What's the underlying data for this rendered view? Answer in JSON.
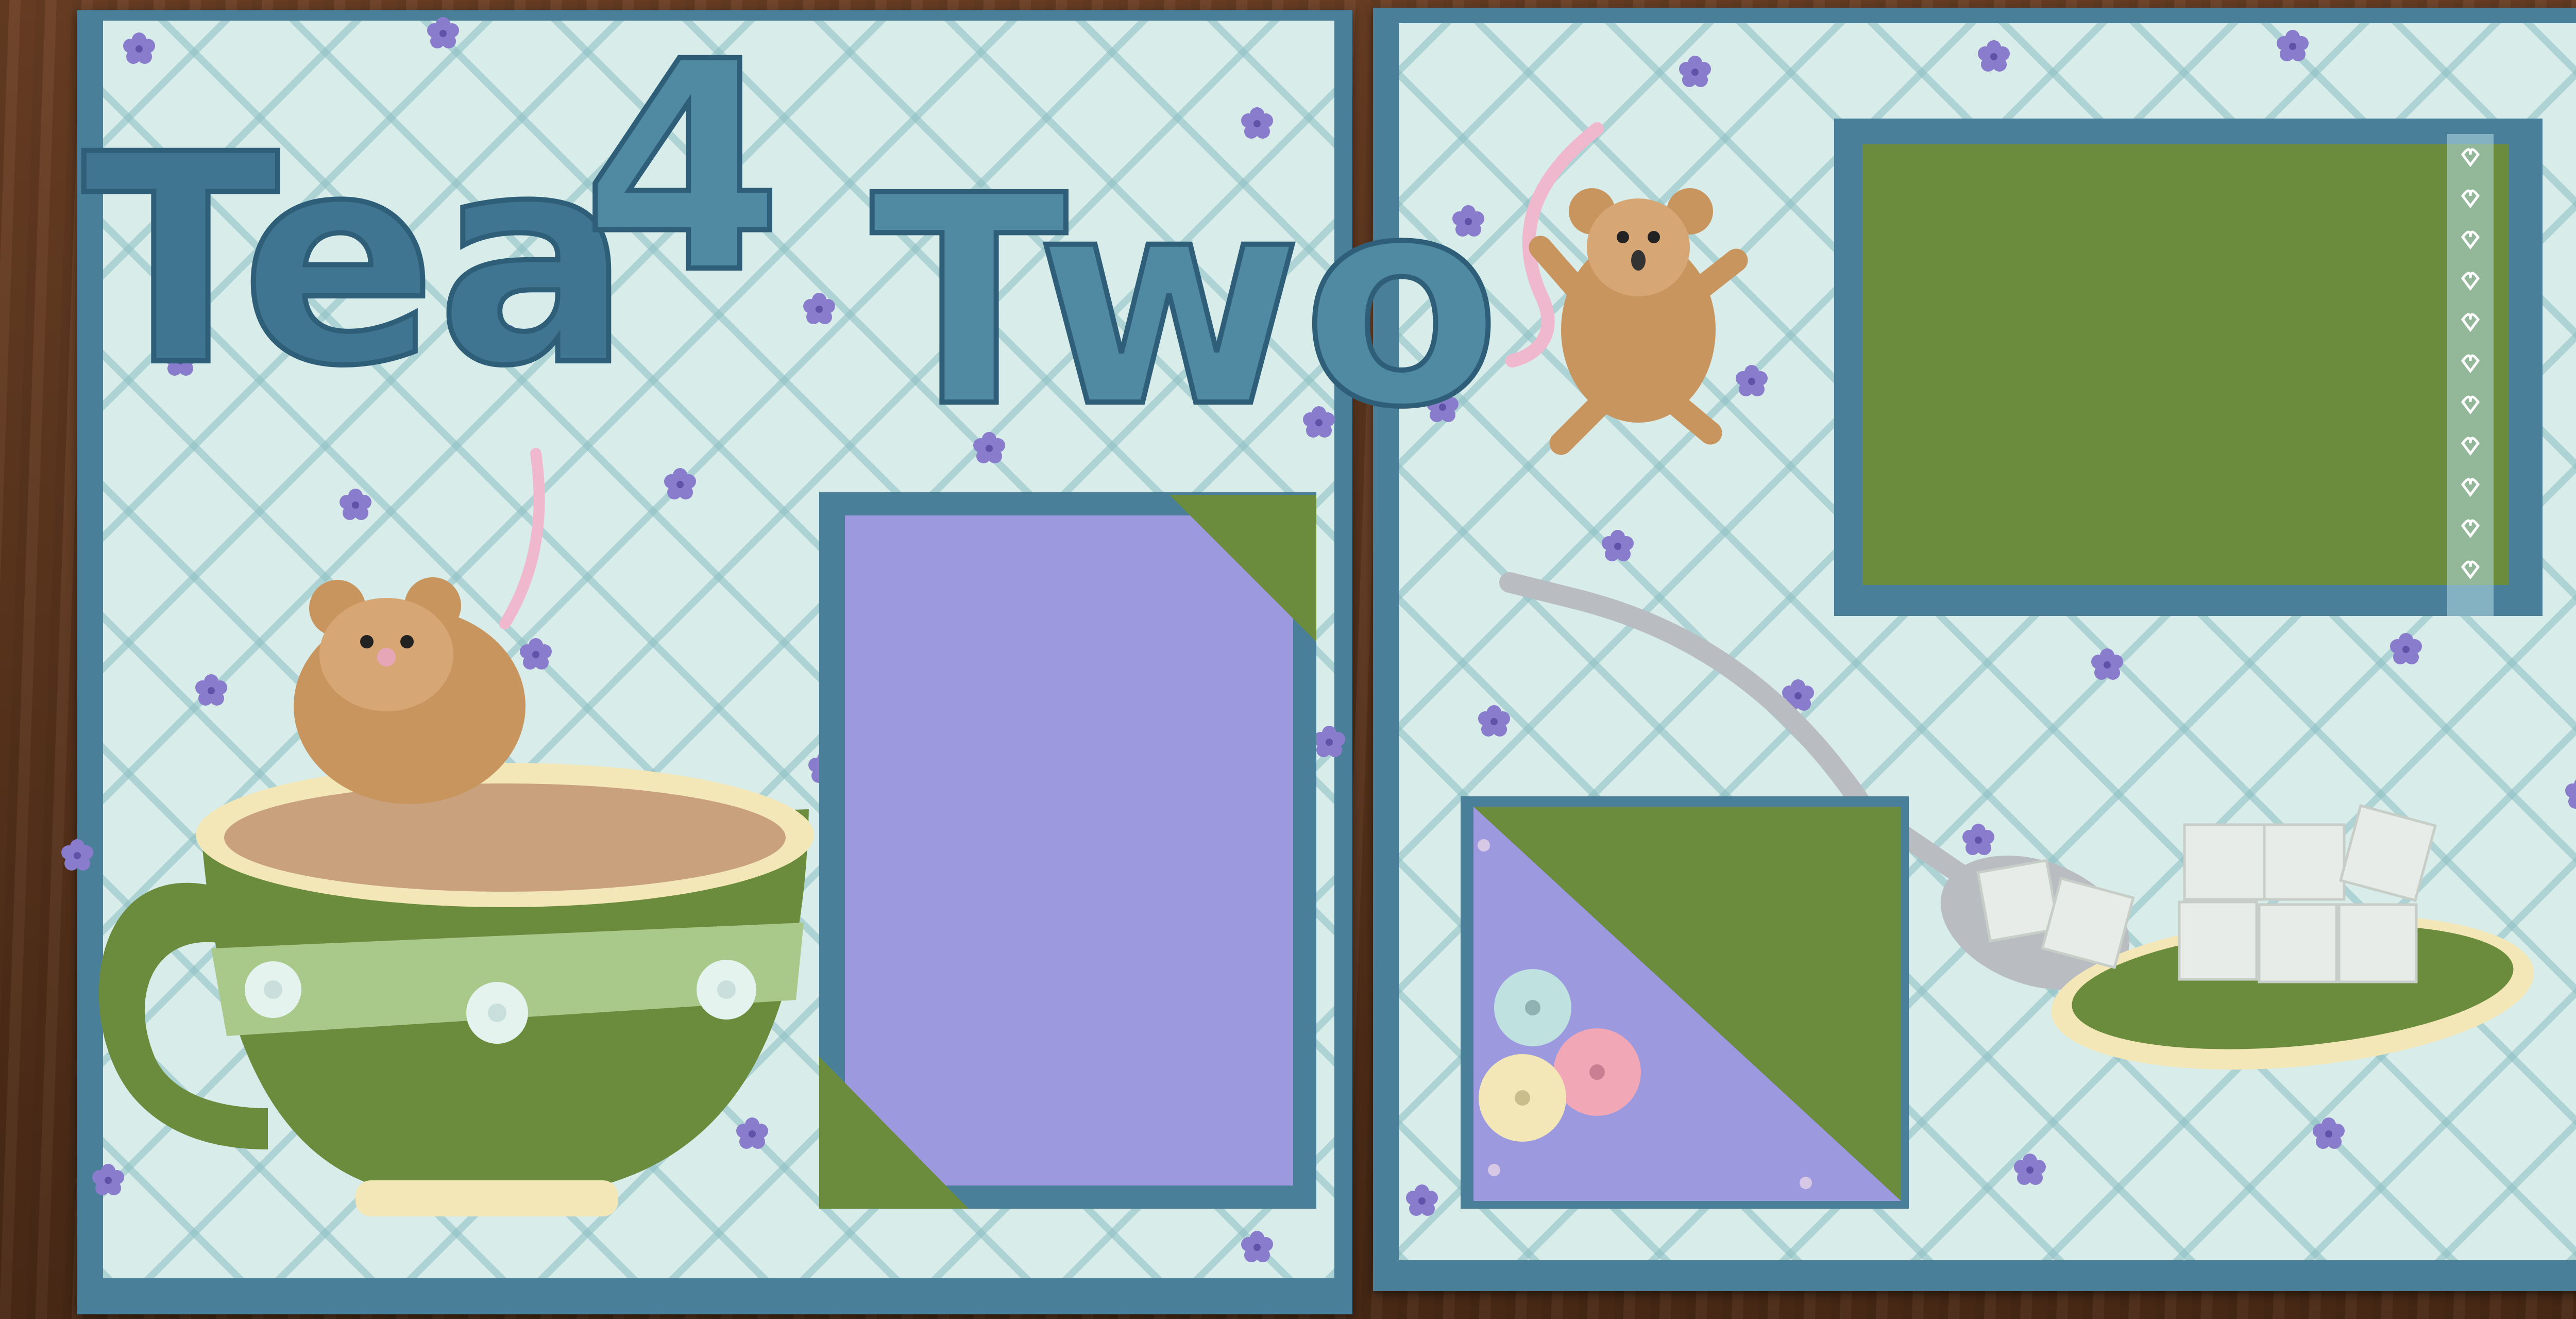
{
  "scene": {
    "description_kind": "scrapbook-layout-photo",
    "colors": {
      "wood": "#5a3520",
      "card_blue": "#4a7f9a",
      "paper": "#d8ecea",
      "title_blue": "#4f89a2",
      "olive_green": "#6b8c3c",
      "lavender": "#9c99de",
      "cream": "#f3e7b8",
      "tea": "#c9a27d",
      "mouse": "#c8955f",
      "silver": "#b9bdc2"
    }
  },
  "title": {
    "word1": "Tea",
    "word2": "4",
    "word3": "Two"
  },
  "decor": {
    "left_mouse_icon": "mouse-icon",
    "right_mouse_icon": "mouse-icon",
    "flower_icon": "flower-icon",
    "heart_ribbon_icon": "heart-icon"
  }
}
